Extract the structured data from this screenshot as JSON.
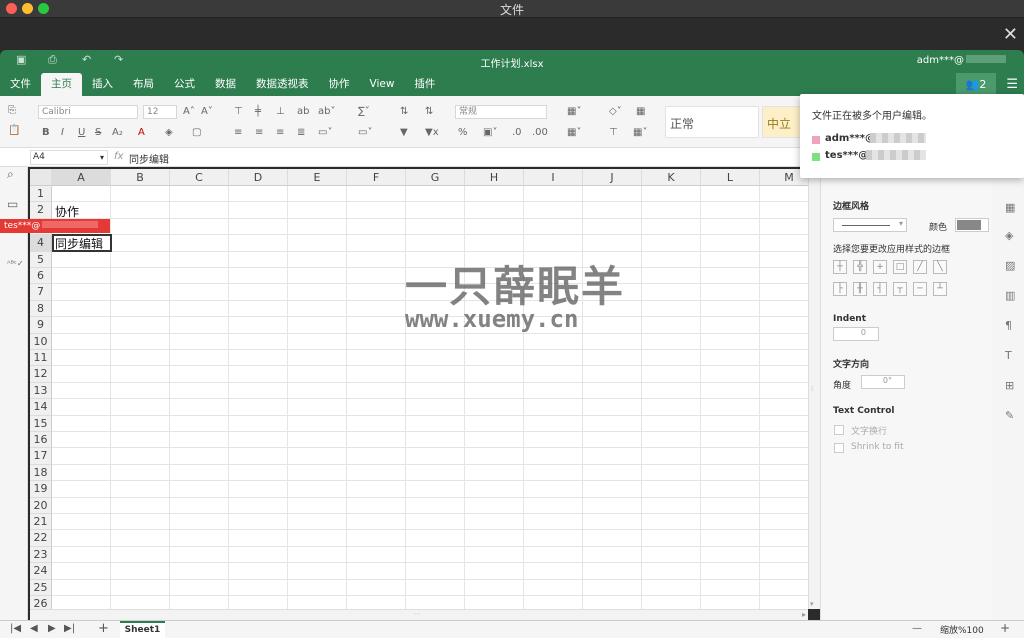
{
  "window": {
    "title": "文件"
  },
  "header": {
    "filename": "工作计划.xlsx",
    "user": "adm***@"
  },
  "tabs": [
    "文件",
    "主页",
    "插入",
    "布局",
    "公式",
    "数据",
    "数据透视表",
    "协作",
    "View",
    "插件"
  ],
  "collab_count": "2",
  "toolbar": {
    "font": "Calibri",
    "size": "12",
    "number_format": "常规",
    "style_normal": "正常",
    "style_neutral": "中立"
  },
  "formula": {
    "cell_ref": "A4",
    "fx": "fx",
    "value": "同步编辑"
  },
  "columns": [
    "A",
    "B",
    "C",
    "D",
    "E",
    "F",
    "G",
    "H",
    "I",
    "J",
    "K",
    "L",
    "M"
  ],
  "rows": [
    "1",
    "2",
    "3",
    "4",
    "5",
    "6",
    "7",
    "8",
    "9",
    "10",
    "11",
    "12",
    "13",
    "14",
    "15",
    "16",
    "17",
    "18",
    "19",
    "20",
    "21",
    "22",
    "23",
    "24",
    "25",
    "26"
  ],
  "cells": {
    "a2": "协作",
    "a4": "同步编辑"
  },
  "user_tag": "tes***@",
  "watermark": {
    "line1": "一只薛眠羊",
    "line2": "www.xuemy.cn"
  },
  "popup": {
    "title": "文件正在被多个用户编辑。",
    "users": [
      {
        "name": "adm***@",
        "color": "#f0a0c0"
      },
      {
        "name": "tes***@",
        "color": "#7ee07e"
      }
    ]
  },
  "panel": {
    "border_style": "边框风格",
    "color": "颜色",
    "apply_border": "选择您要更改应用样式的边框",
    "indent": "Indent",
    "indent_val": "0",
    "text_dir": "文字方向",
    "angle": "角度",
    "angle_val": "0°",
    "text_control": "Text Control",
    "wrap": "文字换行",
    "shrink": "Shrink to fit"
  },
  "bottom": {
    "sheet": "Sheet1",
    "add": "+",
    "zoom": "缩放%100",
    "minus": "—",
    "plus": "+"
  }
}
